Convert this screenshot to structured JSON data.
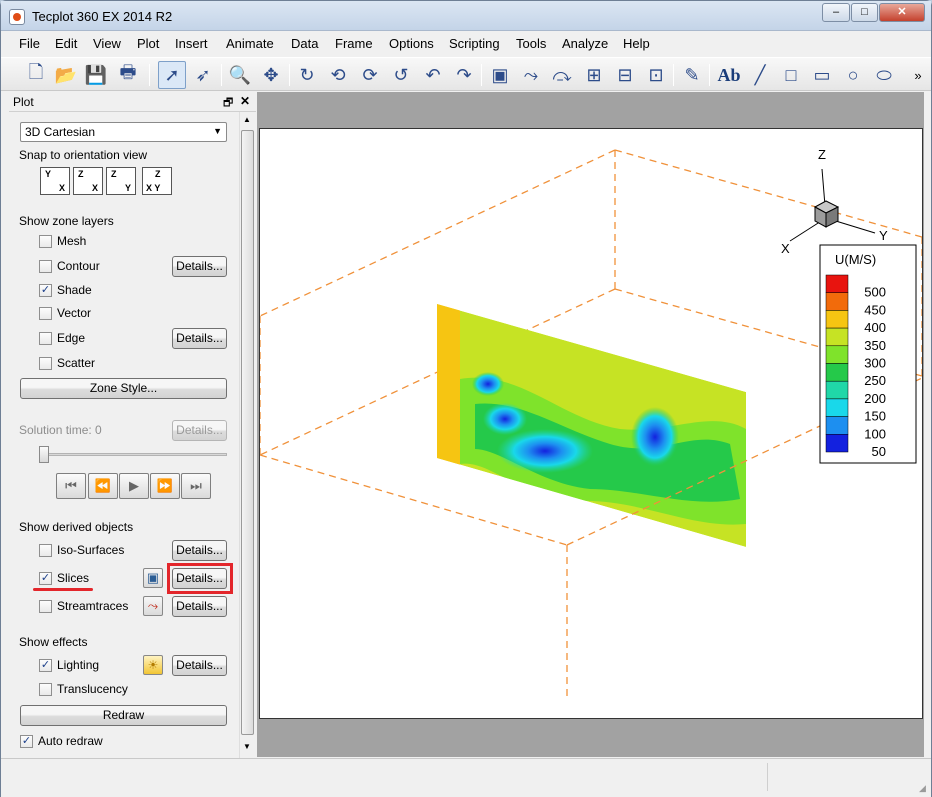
{
  "app": {
    "title": "Tecplot 360 EX 2014 R2",
    "window_controls": [
      "–",
      "□",
      "✕"
    ]
  },
  "menu": [
    "File",
    "Edit",
    "View",
    "Plot",
    "Insert",
    "Animate",
    "Data",
    "Frame",
    "Options",
    "Scripting",
    "Tools",
    "Analyze",
    "Help"
  ],
  "toolbar": {
    "overflow": "»"
  },
  "panel": {
    "title": "Plot",
    "dock_icon": "🗗",
    "close_icon": "✕",
    "plot_type": "3D Cartesian",
    "snap_label": "Snap to orientation view",
    "snap_views": [
      {
        "top": "Y",
        "bottom": "X"
      },
      {
        "top": "Z",
        "bottom": "X"
      },
      {
        "top": "Z",
        "bottom": "Y"
      },
      {
        "top": "Z",
        "bottom": "X Y"
      }
    ],
    "zone_layers_label": "Show zone layers",
    "zone_layers": [
      {
        "label": "Mesh",
        "checked": false
      },
      {
        "label": "Contour",
        "checked": false,
        "details": "Details..."
      },
      {
        "label": "Shade",
        "checked": true
      },
      {
        "label": "Vector",
        "checked": false
      },
      {
        "label": "Edge",
        "checked": false,
        "details": "Details..."
      },
      {
        "label": "Scatter",
        "checked": false
      }
    ],
    "zone_style_button": "Zone Style...",
    "solution_time_label": "Solution time:  0",
    "solution_details": "Details...",
    "derived_label": "Show derived objects",
    "derived": [
      {
        "label": "Iso-Surfaces",
        "checked": false,
        "details": "Details..."
      },
      {
        "label": "Slices",
        "checked": true,
        "details": "Details..."
      },
      {
        "label": "Streamtraces",
        "checked": false,
        "details": "Details..."
      }
    ],
    "effects_label": "Show effects",
    "effects": [
      {
        "label": "Lighting",
        "checked": true,
        "details": "Details..."
      },
      {
        "label": "Translucency",
        "checked": false
      }
    ],
    "redraw_button": "Redraw",
    "auto_redraw": {
      "label": "Auto redraw",
      "checked": true
    }
  },
  "plot": {
    "axis_labels": {
      "x": "X",
      "y": "Y",
      "z": "Z"
    },
    "legend": {
      "title": "U(M/S)",
      "levels": [
        {
          "value": "500",
          "color": "#e8140f"
        },
        {
          "value": "450",
          "color": "#f26b0b"
        },
        {
          "value": "400",
          "color": "#f6c512"
        },
        {
          "value": "350",
          "color": "#c6e324"
        },
        {
          "value": "300",
          "color": "#7fe32b"
        },
        {
          "value": "250",
          "color": "#25c94a"
        },
        {
          "value": "200",
          "color": "#20d7a8"
        },
        {
          "value": "150",
          "color": "#19d8ea"
        },
        {
          "value": "100",
          "color": "#1d8ff0"
        },
        {
          "value": "50",
          "color": "#1321df"
        }
      ]
    },
    "box_line_color": "#f0913a"
  }
}
